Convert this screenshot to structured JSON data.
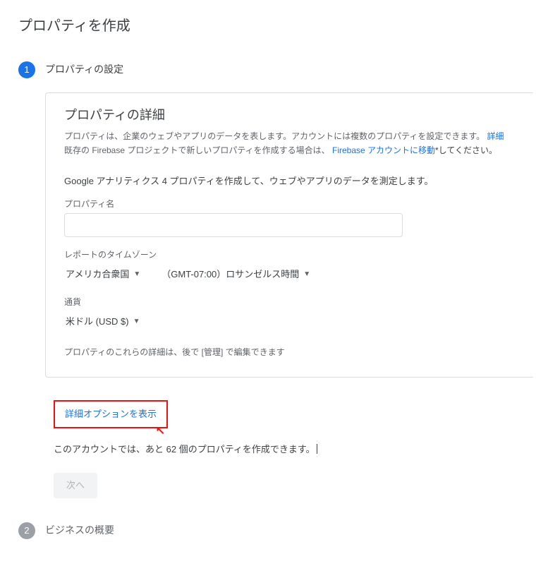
{
  "page_title": "プロパティを作成",
  "steps": {
    "s1": {
      "num": "1",
      "title": "プロパティの設定"
    },
    "s2": {
      "num": "2",
      "title": "ビジネスの概要"
    }
  },
  "card": {
    "title": "プロパティの詳細",
    "help_line1_a": "プロパティは、企業のウェブやアプリのデータを表します。アカウントには複数のプロパティを設定できます。",
    "help_link1": "詳細",
    "help_line2_a": "既存の Firebase プロジェクトで新しいプロパティを作成する場合は、",
    "help_link2": "Firebase アカウントに移動",
    "help_line2_b": "*してください。",
    "section_lead": "Google アナリティクス 4 プロパティを作成して、ウェブやアプリのデータを測定します。",
    "property_name_label": "プロパティ名",
    "property_name_value": "",
    "timezone_label": "レポートのタイムゾーン",
    "country_value": "アメリカ合衆国",
    "tz_value": "（GMT-07:00）ロサンゼルス時間",
    "currency_label": "通貨",
    "currency_value": "米ドル (USD $)",
    "edit_note": "プロパティのこれらの詳細は、後で [管理] で編集できます"
  },
  "advanced_link": "詳細オプションを表示",
  "quota_a": "このアカウントでは、あと ",
  "quota_count": "62",
  "quota_b": " 個のプロパティを作成できます。",
  "next_label": "次へ"
}
